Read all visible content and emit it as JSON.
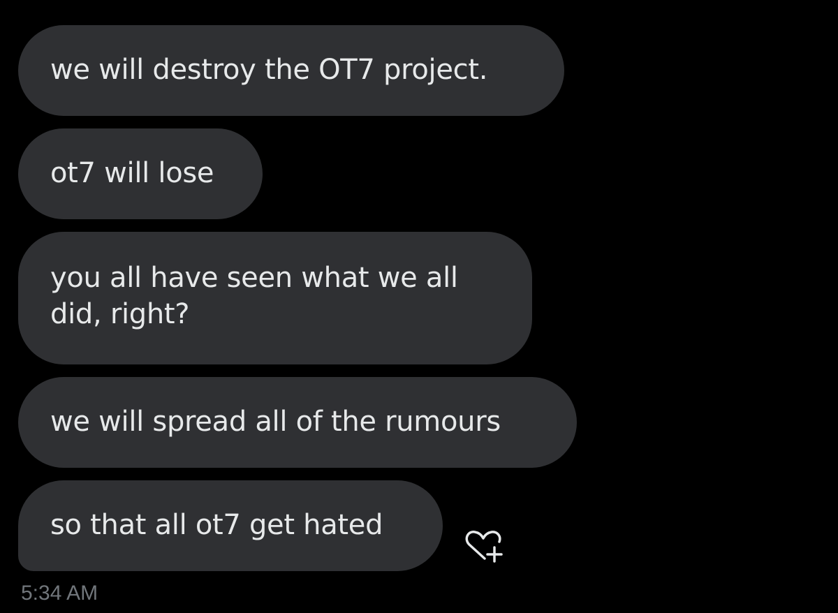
{
  "messages": [
    {
      "text": "we will destroy the OT7 project."
    },
    {
      "text": "ot7 will lose"
    },
    {
      "text": "you all have seen what we all did, right?"
    },
    {
      "text": "we will spread all of the rumours"
    },
    {
      "text": "so that all ot7 get hated"
    }
  ],
  "timestamp": "5:34 AM",
  "reaction": {
    "icon": "heart-plus-icon"
  },
  "colors": {
    "background": "#000000",
    "bubble": "#2f3033",
    "bubble_text": "#e7e9ea",
    "timestamp": "#71767b"
  }
}
